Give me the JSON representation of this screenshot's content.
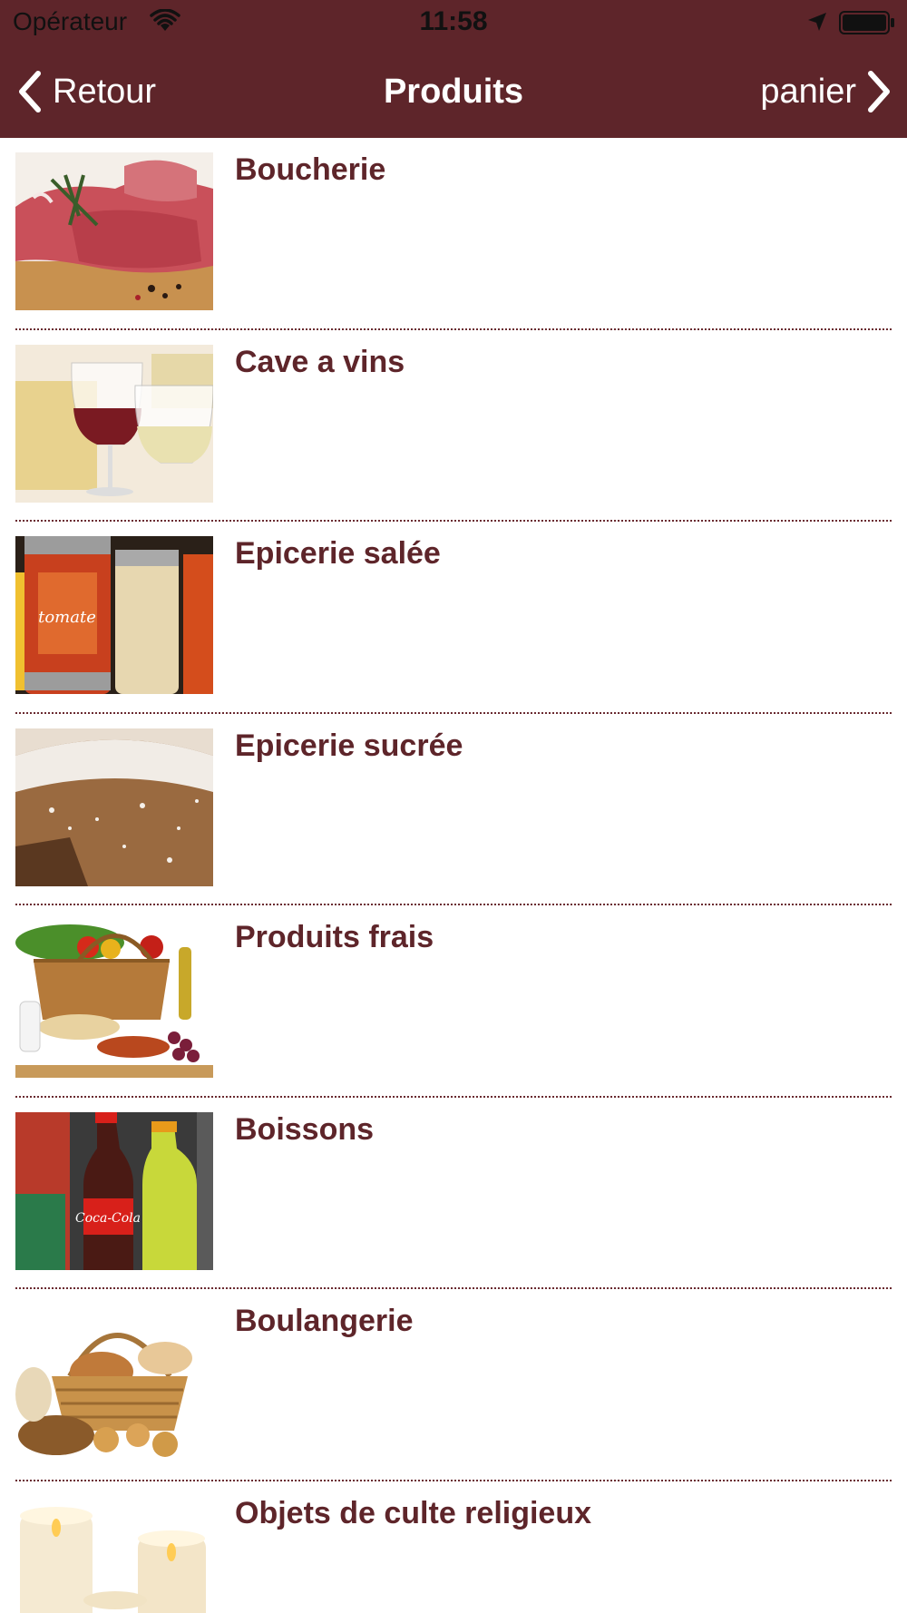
{
  "status_bar": {
    "carrier": "Opérateur",
    "time": "11:58"
  },
  "nav": {
    "back_label": "Retour",
    "title": "Produits",
    "cart_label": "panier"
  },
  "colors": {
    "header_bg": "#5e252a",
    "label_color": "#5e252a",
    "separator": "#6a2a30"
  },
  "categories": [
    {
      "label": "Boucherie",
      "image": "meat-image"
    },
    {
      "label": "Cave a vins",
      "image": "wine-image"
    },
    {
      "label": "Epicerie salée",
      "image": "jars-image"
    },
    {
      "label": "Epicerie sucrée",
      "image": "cake-image"
    },
    {
      "label": "Produits frais",
      "image": "fresh-produce-image"
    },
    {
      "label": "Boissons",
      "image": "drinks-image"
    },
    {
      "label": "Boulangerie",
      "image": "bread-basket-image"
    },
    {
      "label": "Objets de culte religieux",
      "image": "candles-image"
    }
  ]
}
